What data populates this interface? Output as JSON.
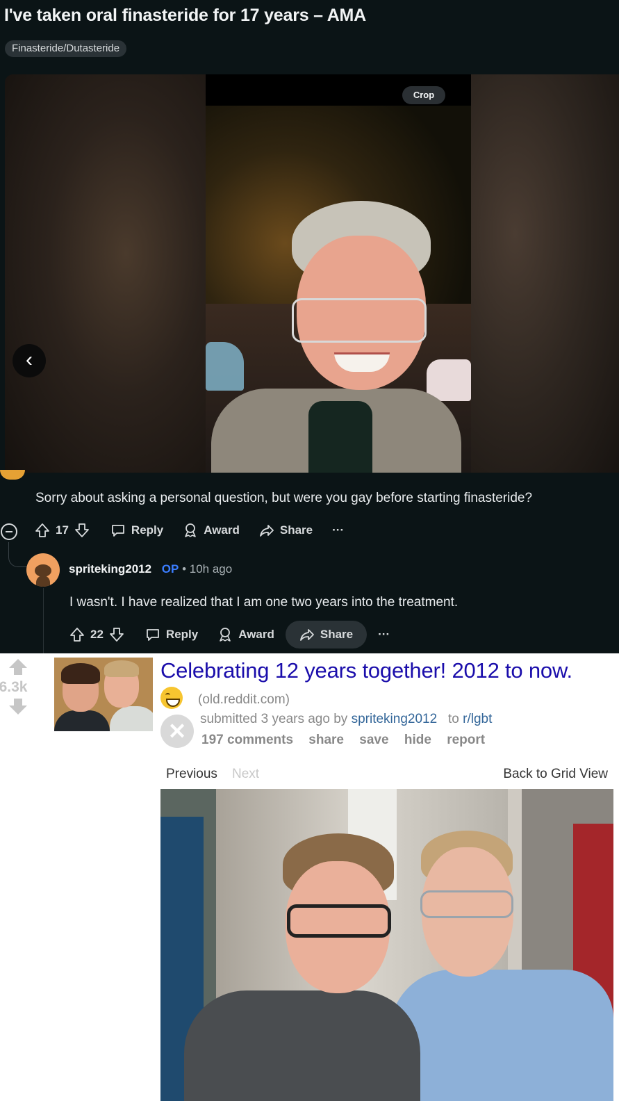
{
  "post": {
    "title": "I've taken oral finasteride for 17 years – AMA",
    "flair": "Finasteride/Dutasteride",
    "gallery": {
      "crop_label": "Crop"
    }
  },
  "comment": {
    "text": "Sorry about asking a personal question, but were you gay before starting finasteride?",
    "score": "17",
    "actions": {
      "reply": "Reply",
      "award": "Award",
      "share": "Share",
      "more": "···"
    }
  },
  "reply": {
    "username": "spriteking2012",
    "op_badge": "OP",
    "time": "• 10h ago",
    "text": "I wasn't. I have realized that I am one two years into the treatment.",
    "score": "22",
    "actions": {
      "reply": "Reply",
      "award": "Award",
      "share": "Share",
      "more": "···"
    }
  },
  "old_reddit": {
    "score": "6.3k",
    "title": "Celebrating 12 years together! 2012 to now.",
    "domain": "(old.reddit.com)",
    "submitted_prefix": "submitted 3 years ago by",
    "author": "spriteking2012",
    "to_prefix": "to",
    "subreddit": "r/lgbt",
    "buttons": {
      "comments": "197 comments",
      "share": "share",
      "save": "save",
      "hide": "hide",
      "report": "report"
    },
    "nav": {
      "previous": "Previous",
      "next": "Next",
      "back": "Back to Grid View"
    }
  },
  "colors": {
    "dark_bg": "#0b1416",
    "op_badge": "#3b7dff",
    "old_reddit_link": "#1a0dab",
    "old_reddit_meta_link": "#336699"
  },
  "icons": [
    "chevron-left-icon",
    "collapse-icon",
    "upvote-icon",
    "downvote-icon",
    "comment-icon",
    "award-icon",
    "share-icon",
    "more-icon",
    "hide-x-icon",
    "emoji-grin-icon"
  ]
}
